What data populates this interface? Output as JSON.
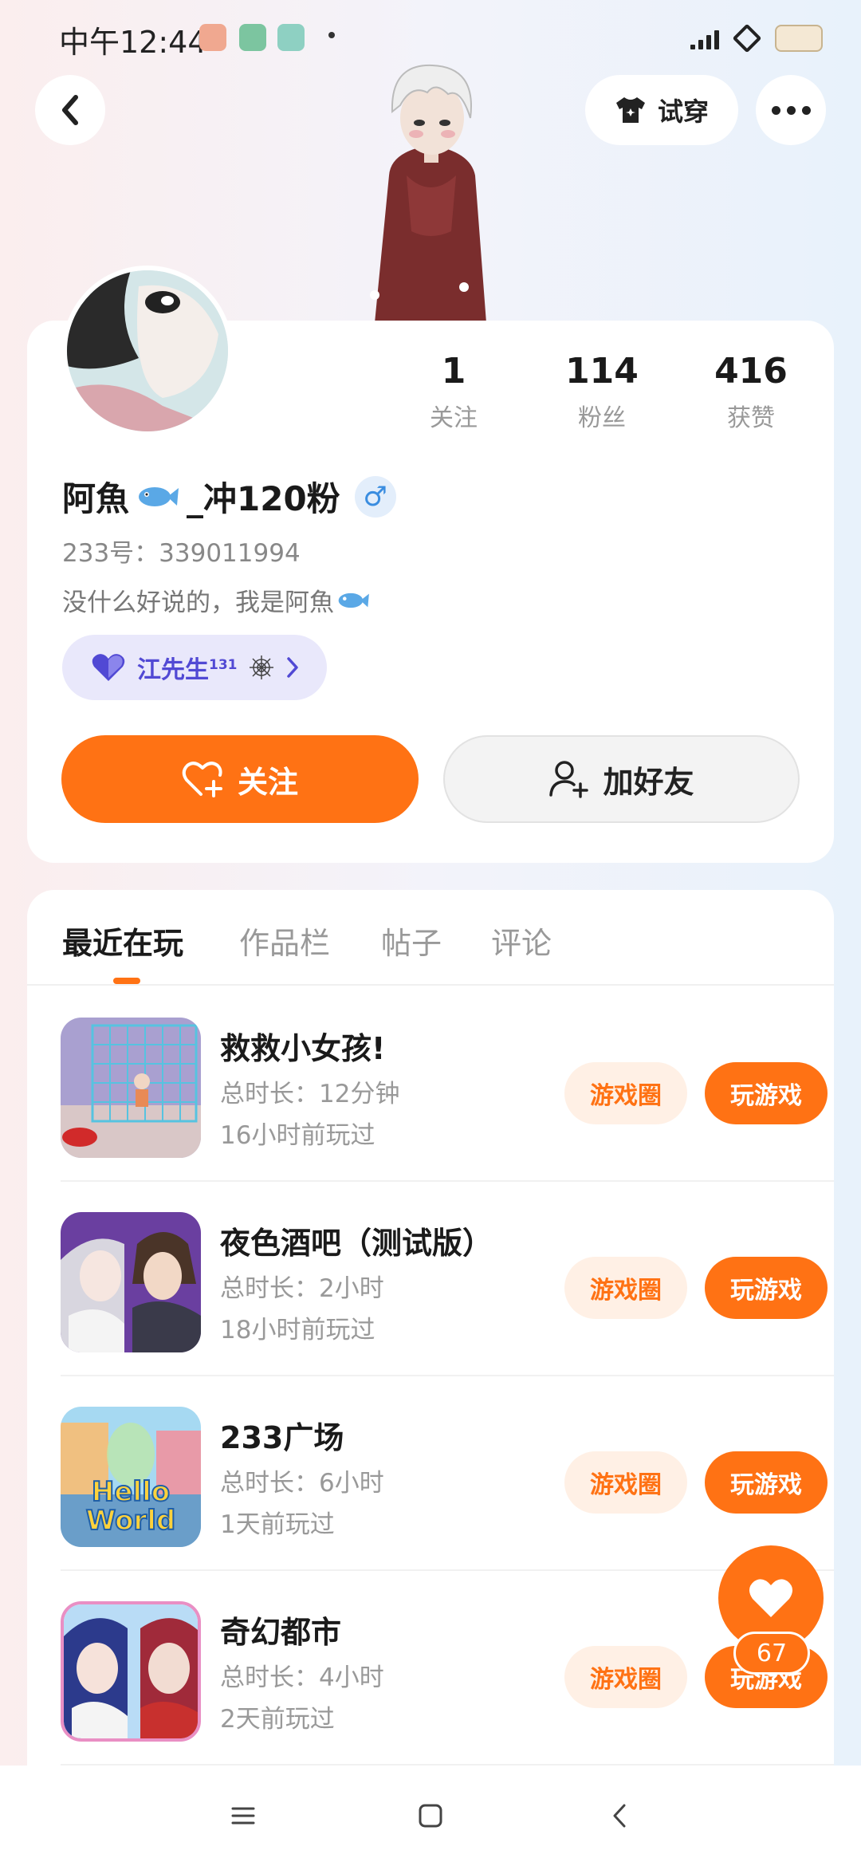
{
  "status_bar": {
    "time": "中午12:44"
  },
  "header": {
    "tryon_label": "试穿"
  },
  "profile": {
    "stats": [
      {
        "value": "1",
        "label": "关注"
      },
      {
        "value": "114",
        "label": "粉丝"
      },
      {
        "value": "416",
        "label": "获赞"
      }
    ],
    "username_prefix": "阿魚",
    "username_suffix": "_冲120粉",
    "gender_symbol": "♂",
    "user_id": "233号：339011994",
    "bio": "没什么好说的，我是阿魚",
    "couple_name": "江先生",
    "couple_level": "131",
    "follow_label": "关注",
    "add_friend_label": "加好友"
  },
  "tabs": [
    {
      "label": "最近在玩",
      "active": true
    },
    {
      "label": "作品栏",
      "active": false
    },
    {
      "label": "帖子",
      "active": false
    },
    {
      "label": "评论",
      "active": false
    }
  ],
  "games": [
    {
      "title": "救救小女孩!",
      "duration": "总时长：12分钟",
      "last_played": "16小时前玩过",
      "circle_label": "游戏圈",
      "play_label": "玩游戏"
    },
    {
      "title": "夜色酒吧（测试版）",
      "duration": "总时长：2小时",
      "last_played": "18小时前玩过",
      "circle_label": "游戏圈",
      "play_label": "玩游戏"
    },
    {
      "title": "233广场",
      "duration": "总时长：6小时",
      "last_played": "1天前玩过",
      "circle_label": "游戏圈",
      "play_label": "玩游戏"
    },
    {
      "title": "奇幻都市",
      "duration": "总时长：4小时",
      "last_played": "2天前玩过",
      "circle_label": "游戏圈",
      "play_label": "玩游戏"
    }
  ],
  "game_thumb_texts": {
    "hello_world_line1": "Hello",
    "hello_world_line2": "World"
  },
  "like_fab": {
    "count": "67"
  },
  "colors": {
    "accent": "#ff7214",
    "accent_light": "#fff0e5",
    "couple_bg": "#e9e8fb",
    "couple_text": "#5149d4"
  },
  "icons": {
    "back": "chevron-left-icon",
    "tryon": "tshirt-icon",
    "more": "more-dots-icon",
    "gender": "male-icon",
    "couple": "heart-icon",
    "follow": "heart-plus-icon",
    "add_friend": "user-plus-icon",
    "like": "heart-icon",
    "nav": [
      "menu-icon",
      "home-square-icon",
      "back-chevron-icon"
    ]
  }
}
